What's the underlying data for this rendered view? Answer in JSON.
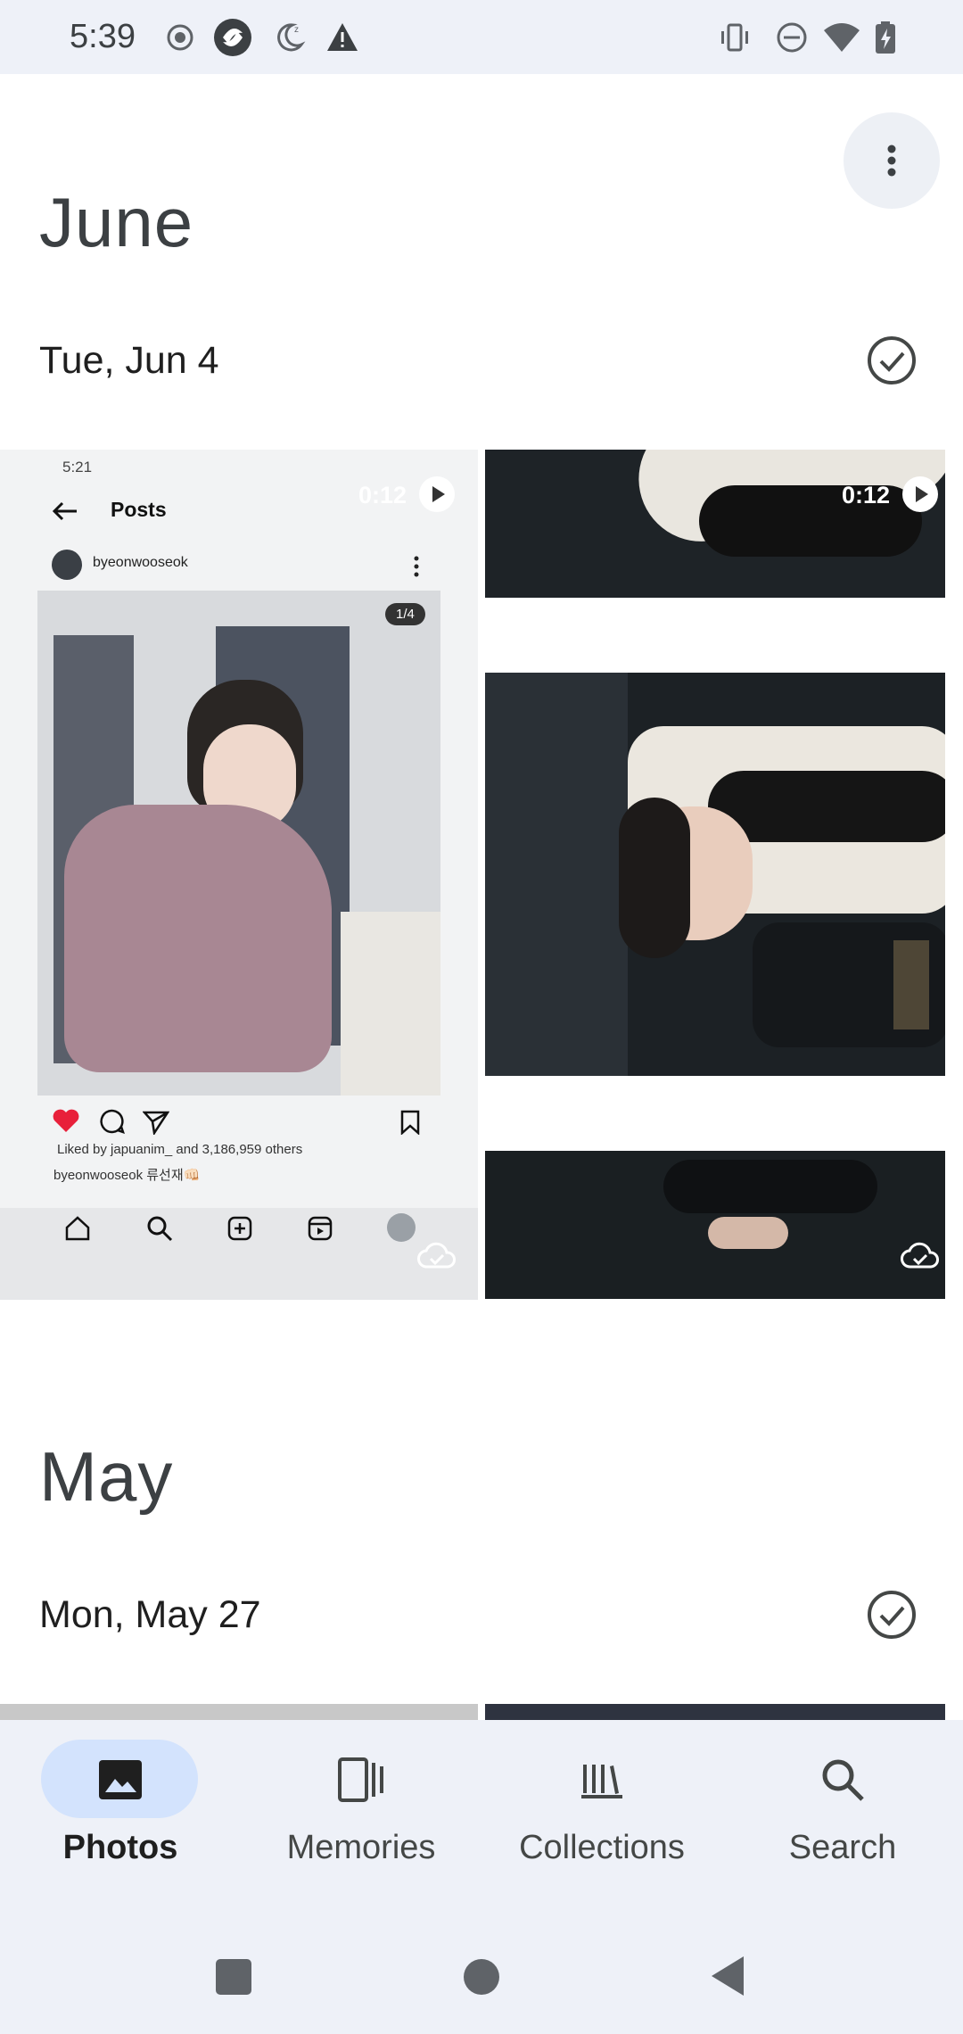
{
  "status_bar": {
    "time": "5:39",
    "left_icons": [
      "record-icon",
      "app-icon",
      "do-not-disturb-moon-icon",
      "warning-icon"
    ],
    "right_icons": [
      "vibrate-icon",
      "dnd-icon",
      "wifi-icon",
      "battery-charging-icon"
    ]
  },
  "header": {
    "more_icon": "more-vert-icon"
  },
  "sections": [
    {
      "month": "June",
      "day": "Tue, Jun 4",
      "items": [
        {
          "kind": "video",
          "duration": "0:12",
          "inner": {
            "status_time": "5:21",
            "title": "Posts",
            "user": "byeonwooseok",
            "counter": "1/4",
            "liked": "Liked by japuanim_ and 3,186,959 others",
            "caption": "byeonwooseok 류선재👊🏻"
          }
        },
        {
          "kind": "video",
          "duration": "0:12"
        }
      ]
    },
    {
      "month": "May",
      "day": "Mon, May 27"
    }
  ],
  "bottom_nav": {
    "items": [
      {
        "label": "Photos",
        "icon": "photo-icon",
        "active": true
      },
      {
        "label": "Memories",
        "icon": "memories-icon",
        "active": false
      },
      {
        "label": "Collections",
        "icon": "collections-icon",
        "active": false
      },
      {
        "label": "Search",
        "icon": "search-icon",
        "active": false
      }
    ]
  },
  "system_nav": {
    "buttons": [
      "recents-icon",
      "home-icon",
      "back-icon"
    ]
  },
  "colors": {
    "bar_bg": "#eef1f8",
    "active_pill": "#d3e3fd",
    "text": "#1f1f1f"
  }
}
